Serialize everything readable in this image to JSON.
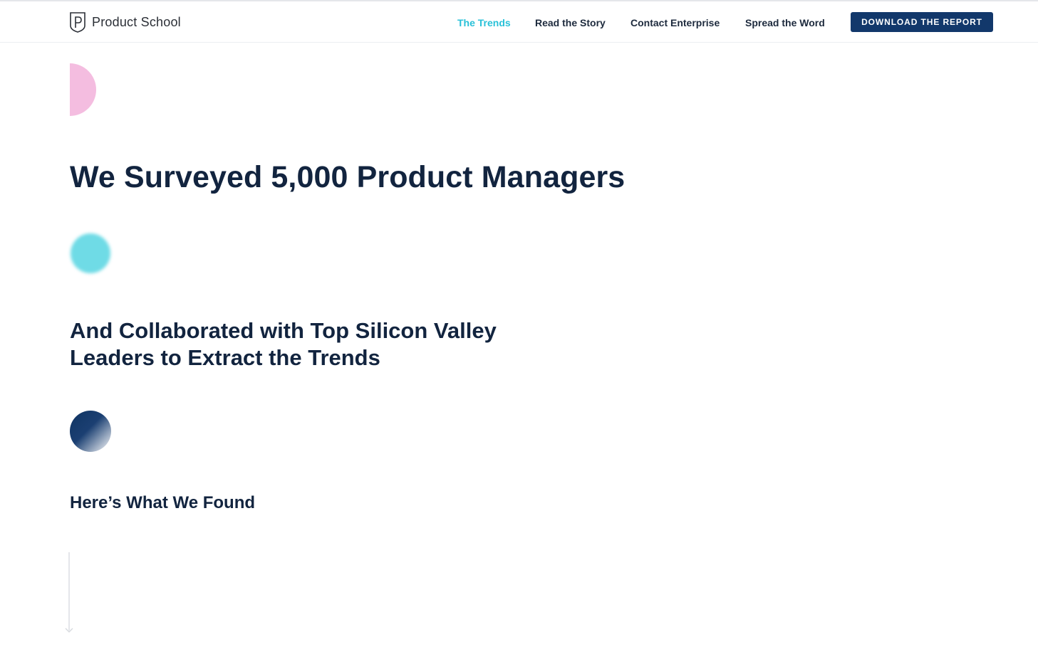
{
  "header": {
    "logo_text": "Product School",
    "nav": [
      {
        "label": "The Trends",
        "active": true
      },
      {
        "label": "Read the Story",
        "active": false
      },
      {
        "label": "Contact Enterprise",
        "active": false
      },
      {
        "label": "Spread the Word",
        "active": false
      }
    ],
    "cta_label": "Download the Report"
  },
  "hero": {
    "headline": "We Surveyed 5,000 Product Managers",
    "subheadline": "And Collaborated with Top Silicon Valley Leaders to Extract the Trends",
    "tagline": "Here’s What We Found"
  },
  "colors": {
    "accent_teal": "#28c1d8",
    "navy": "#12386b",
    "pink": "#f4bde0",
    "cyan_dot": "#6fdbe6",
    "text_dark": "#12243f"
  },
  "icons": {
    "logo": "shield-p-logo-icon",
    "scroll": "arrow-down-icon"
  }
}
